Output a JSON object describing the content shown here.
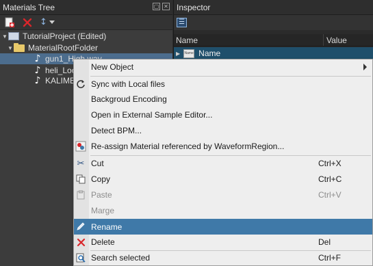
{
  "left_panel": {
    "title": "Materials Tree",
    "toolbar": {
      "sort_label": "↕"
    },
    "tree": [
      {
        "label": "TutorialProject (Edited)",
        "kind": "project",
        "expanded": true
      },
      {
        "label": "MaterialRootFolder",
        "kind": "folder",
        "expanded": true
      },
      {
        "label": "gun1_High.wav",
        "kind": "audio",
        "selected": true
      },
      {
        "label": "heli_Loc",
        "kind": "audio"
      },
      {
        "label": "KALIMB",
        "kind": "audio"
      }
    ]
  },
  "right_panel": {
    "title": "Inspector",
    "columns": {
      "name": "Name",
      "value": "Value"
    },
    "rows": [
      {
        "label": "Name",
        "icon_text": "Name"
      }
    ]
  },
  "context_menu": {
    "items": [
      {
        "label": "New Object",
        "shortcut": "",
        "submenu": true,
        "icon": ""
      },
      {
        "label": "Sync with Local files",
        "shortcut": "",
        "icon": "sync-icon"
      },
      {
        "label": "Backgroud Encoding",
        "shortcut": "",
        "icon": ""
      },
      {
        "label": "Open in External Sample Editor...",
        "shortcut": "",
        "icon": ""
      },
      {
        "label": "Detect BPM...",
        "shortcut": "",
        "icon": ""
      },
      {
        "label": "Re-assign Material referenced by WaveformRegion...",
        "shortcut": "",
        "icon": "reassign-icon"
      },
      {
        "label": "Cut",
        "shortcut": "Ctrl+X",
        "icon": "scissors-icon"
      },
      {
        "label": "Copy",
        "shortcut": "Ctrl+C",
        "icon": "copy-icon"
      },
      {
        "label": "Paste",
        "shortcut": "Ctrl+V",
        "icon": "paste-icon",
        "disabled": true
      },
      {
        "label": "Marge",
        "shortcut": "",
        "icon": "",
        "disabled": true
      },
      {
        "label": "Rename",
        "shortcut": "",
        "icon": "pencil-icon",
        "highlighted": true
      },
      {
        "label": "Delete",
        "shortcut": "Del",
        "icon": "delete-icon"
      },
      {
        "label": "Search selected",
        "shortcut": "Ctrl+F",
        "icon": "search-icon"
      }
    ]
  },
  "colors": {
    "selection": "#4c6d8e",
    "menu_highlight": "#3f79a8",
    "delete_red": "#d9262b"
  }
}
